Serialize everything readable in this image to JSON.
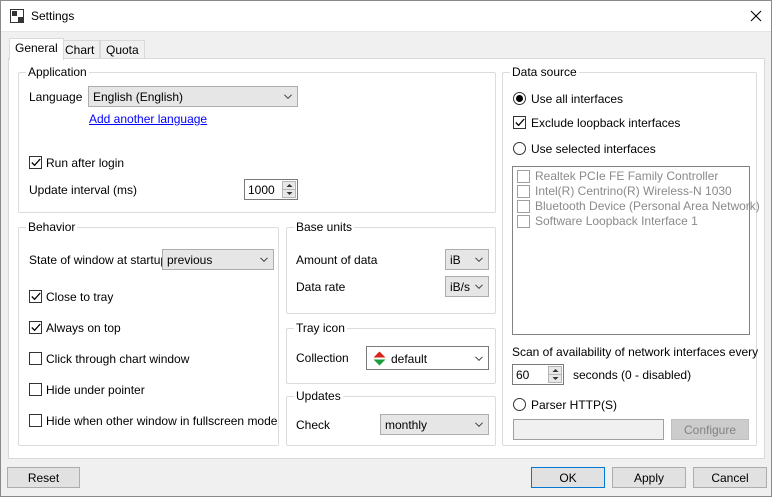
{
  "window": {
    "title": "Settings"
  },
  "tabs": [
    {
      "label": "General"
    },
    {
      "label": "Chart"
    },
    {
      "label": "Quota"
    }
  ],
  "application": {
    "group_label": "Application",
    "language_label": "Language",
    "language_value": "English (English)",
    "add_language_link": "Add another language",
    "run_after_login_label": "Run after login",
    "run_after_login_checked": true,
    "update_interval_label": "Update interval (ms)",
    "update_interval_value": "1000"
  },
  "behavior": {
    "group_label": "Behavior",
    "startup_state_label": "State of window at startup",
    "startup_state_value": "previous",
    "options": [
      {
        "label": "Close to tray",
        "checked": true
      },
      {
        "label": "Always on top",
        "checked": true
      },
      {
        "label": "Click through chart window",
        "checked": false
      },
      {
        "label": "Hide under pointer",
        "checked": false
      },
      {
        "label": "Hide when other window in fullscreen mode",
        "checked": false
      }
    ]
  },
  "base_units": {
    "group_label": "Base units",
    "amount_label": "Amount of data",
    "amount_value": "iB",
    "rate_label": "Data rate",
    "rate_value": "iB/s"
  },
  "tray_icon": {
    "group_label": "Tray icon",
    "collection_label": "Collection",
    "collection_value": "default"
  },
  "updates": {
    "group_label": "Updates",
    "check_label": "Check",
    "check_value": "monthly"
  },
  "data_source": {
    "group_label": "Data source",
    "use_all_label": "Use all interfaces",
    "exclude_loopback_label": "Exclude loopback interfaces",
    "use_selected_label": "Use selected interfaces",
    "interfaces": [
      {
        "label": "Realtek PCIe FE Family Controller"
      },
      {
        "label": "Intel(R) Centrino(R) Wireless-N 1030"
      },
      {
        "label": "Bluetooth Device (Personal Area Network)"
      },
      {
        "label": "Software Loopback Interface 1"
      }
    ],
    "scan_label": "Scan of availability of network interfaces every",
    "scan_value": "60",
    "scan_suffix": "seconds (0 - disabled)",
    "parser_label": "Parser HTTP(S)",
    "parser_value": "",
    "configure_label": "Configure"
  },
  "footer": {
    "reset_label": "Reset",
    "ok_label": "OK",
    "apply_label": "Apply",
    "cancel_label": "Cancel"
  },
  "colors": {
    "accent": "#0078d7",
    "link": "#0000ff",
    "tray_up": "#d9261c",
    "tray_down": "#1e9e3a"
  }
}
